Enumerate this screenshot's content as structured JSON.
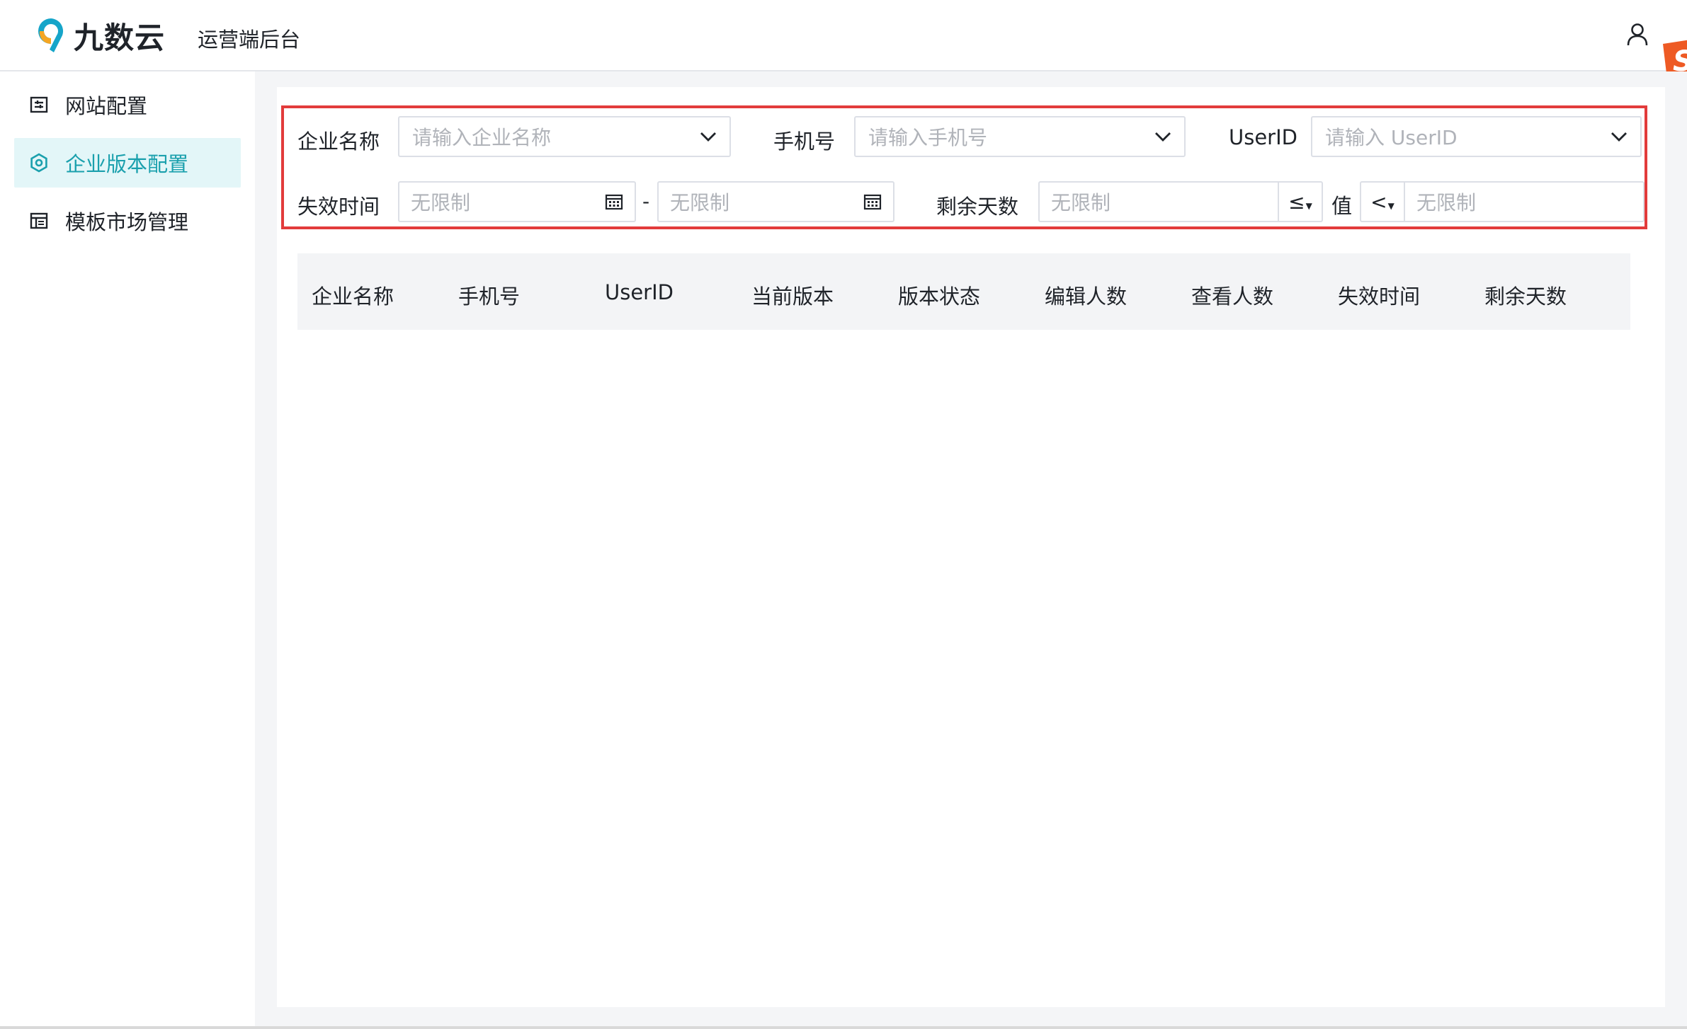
{
  "header": {
    "brand": "九数云",
    "subtitle": "运营端后台",
    "user_icon": "user-icon"
  },
  "sidebar": {
    "items": [
      {
        "label": "网站配置",
        "icon": "site-config-icon",
        "active": false
      },
      {
        "label": "企业版本配置",
        "icon": "gear-icon",
        "active": true
      },
      {
        "label": "模板市场管理",
        "icon": "template-icon",
        "active": false
      }
    ]
  },
  "filters": {
    "company_name": {
      "label": "企业名称",
      "placeholder": "请输入企业名称"
    },
    "phone": {
      "label": "手机号",
      "placeholder": "请输入手机号"
    },
    "userid": {
      "label": "UserID",
      "placeholder": "请输入 UserID"
    },
    "expire_time": {
      "label": "失效时间",
      "start_placeholder": "无限制",
      "separator": "-",
      "end_placeholder": "无限制"
    },
    "remaining_days": {
      "label": "剩余天数",
      "min_placeholder": "无限制",
      "op1": "≤",
      "value_label": "值",
      "op2": "<",
      "max_placeholder": "无限制"
    }
  },
  "table": {
    "columns": [
      "企业名称",
      "手机号",
      "UserID",
      "当前版本",
      "版本状态",
      "编辑人数",
      "查看人数",
      "失效时间",
      "剩余天数"
    ],
    "rows": []
  },
  "colors": {
    "accent": "#1aa0ad",
    "active_bg": "#e3f6f8",
    "highlight_border": "#e23b3b",
    "logo_orange": "#f5a623",
    "logo_teal": "#16a5c9"
  }
}
